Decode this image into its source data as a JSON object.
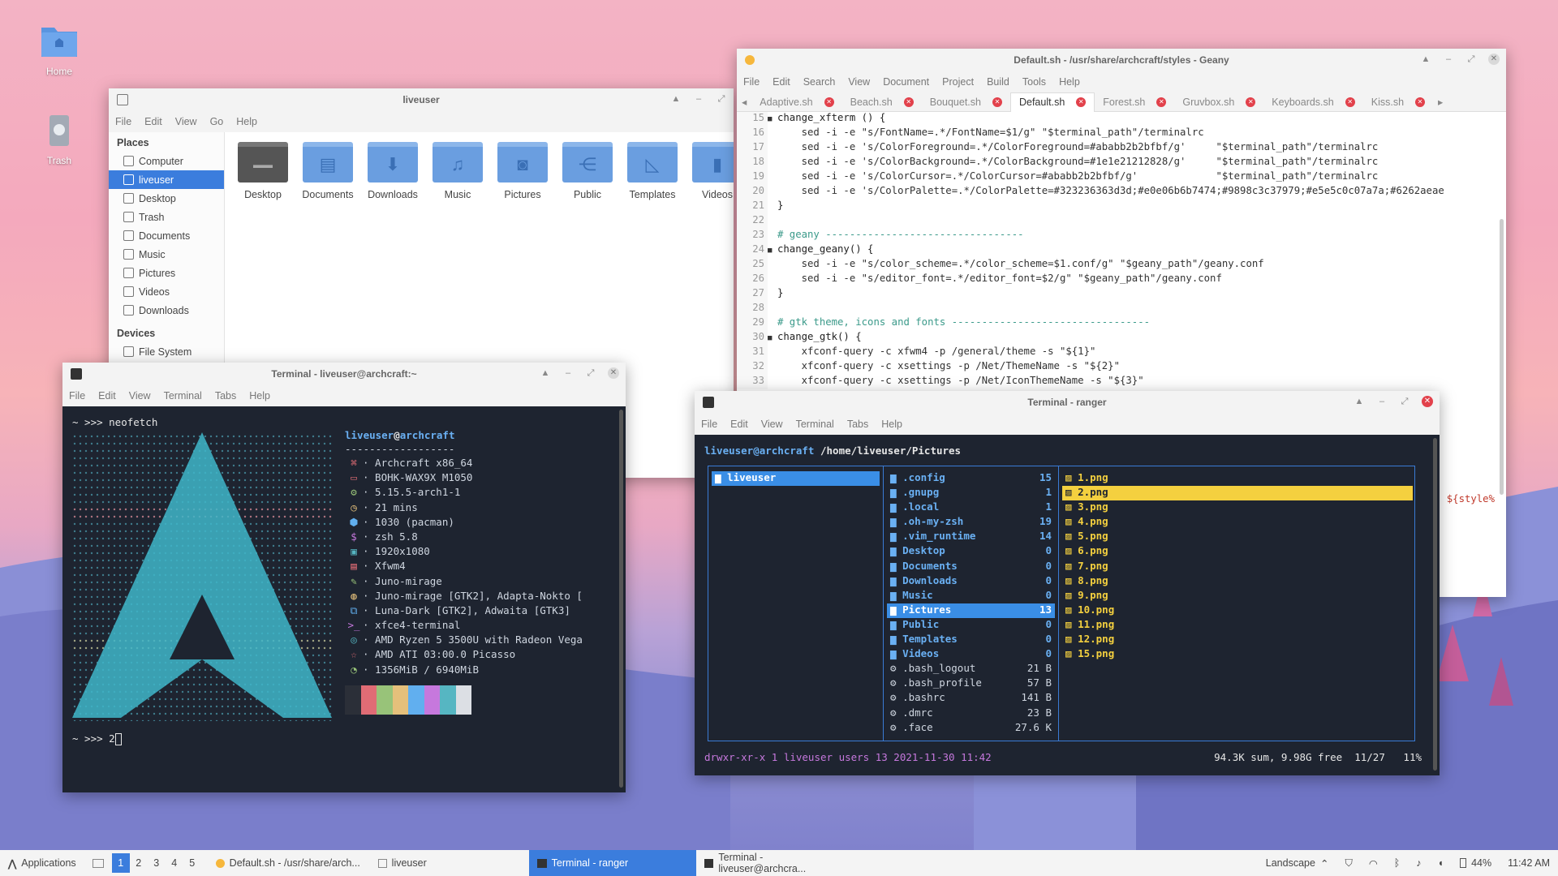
{
  "desktop": {
    "icons": [
      {
        "label": "Home"
      },
      {
        "label": "Trash"
      }
    ]
  },
  "filemanager": {
    "title": "liveuser",
    "menu": [
      "File",
      "Edit",
      "View",
      "Go",
      "Help"
    ],
    "places_header": "Places",
    "places": [
      "Computer",
      "liveuser",
      "Desktop",
      "Trash",
      "Documents",
      "Music",
      "Pictures",
      "Videos",
      "Downloads"
    ],
    "devices_header": "Devices",
    "devices": [
      "File System"
    ],
    "folders": [
      "Desktop",
      "Documents",
      "Downloads",
      "Music",
      "Pictures",
      "Public",
      "Templates",
      "Videos"
    ]
  },
  "geany": {
    "title": "Default.sh - /usr/share/archcraft/styles - Geany",
    "menu": [
      "File",
      "Edit",
      "Search",
      "View",
      "Document",
      "Project",
      "Build",
      "Tools",
      "Help"
    ],
    "tabs": [
      "Adaptive.sh",
      "Beach.sh",
      "Bouquet.sh",
      "Default.sh",
      "Forest.sh",
      "Gruvbox.sh",
      "Keyboards.sh",
      "Kiss.sh"
    ],
    "active_tab": "Default.sh",
    "lines": [
      {
        "n": "15",
        "t": "change_xfterm () {",
        "fold": true
      },
      {
        "n": "16",
        "t": "    sed -i -e \"s/FontName=.*/FontName=$1/g\" \"$terminal_path\"/terminalrc"
      },
      {
        "n": "17",
        "t": "    sed -i -e 's/ColorForeground=.*/ColorForeground=#ababb2b2bfbf/g'     \"$terminal_path\"/terminalrc"
      },
      {
        "n": "18",
        "t": "    sed -i -e 's/ColorBackground=.*/ColorBackground=#1e1e21212828/g'     \"$terminal_path\"/terminalrc"
      },
      {
        "n": "19",
        "t": "    sed -i -e 's/ColorCursor=.*/ColorCursor=#ababb2b2bfbf/g'             \"$terminal_path\"/terminalrc"
      },
      {
        "n": "20",
        "t": "    sed -i -e 's/ColorPalette=.*/ColorPalette=#323236363d3d;#e0e06b6b7474;#9898c3c37979;#e5e5c0c07a7a;#6262aeae"
      },
      {
        "n": "21",
        "t": "}"
      },
      {
        "n": "22",
        "t": ""
      },
      {
        "n": "23",
        "t": "# geany ---------------------------------"
      },
      {
        "n": "24",
        "t": "change_geany() {",
        "fold": true
      },
      {
        "n": "25",
        "t": "    sed -i -e \"s/color_scheme=.*/color_scheme=$1.conf/g\" \"$geany_path\"/geany.conf"
      },
      {
        "n": "26",
        "t": "    sed -i -e \"s/editor_font=.*/editor_font=$2/g\" \"$geany_path\"/geany.conf"
      },
      {
        "n": "27",
        "t": "}"
      },
      {
        "n": "28",
        "t": ""
      },
      {
        "n": "29",
        "t": "# gtk theme, icons and fonts ---------------------------------"
      },
      {
        "n": "30",
        "t": "change_gtk() {",
        "fold": true
      },
      {
        "n": "31",
        "t": "    xfconf-query -c xfwm4 -p /general/theme -s \"${1}\""
      },
      {
        "n": "32",
        "t": "    xfconf-query -c xsettings -p /Net/ThemeName -s \"${2}\""
      },
      {
        "n": "33",
        "t": "    xfconf-query -c xsettings -p /Net/IconThemeName -s \"${3}\""
      }
    ],
    "hidden_fragment": "${style%"
  },
  "term1": {
    "title": "Terminal - liveuser@archcraft:~",
    "menu": [
      "File",
      "Edit",
      "View",
      "Terminal",
      "Tabs",
      "Help"
    ],
    "prompt1": "~ >>> neofetch",
    "user": "liveuser",
    "host": "archcraft",
    "sep": "------------------",
    "info": [
      {
        "icon": "⌘",
        "text": "· Archcraft x86_64"
      },
      {
        "icon": "▭",
        "text": "· BOHK-WAX9X M1050"
      },
      {
        "icon": "⚙",
        "text": "· 5.15.5-arch1-1"
      },
      {
        "icon": "◷",
        "text": "· 21 mins"
      },
      {
        "icon": "⬢",
        "text": "· 1030 (pacman)"
      },
      {
        "icon": "$",
        "text": "· zsh 5.8"
      },
      {
        "icon": "▣",
        "text": "· 1920x1080"
      },
      {
        "icon": "▤",
        "text": "· Xfwm4"
      },
      {
        "icon": "✎",
        "text": "· Juno-mirage"
      },
      {
        "icon": "◍",
        "text": "· Juno-mirage [GTK2], Adapta-Nokto ["
      },
      {
        "icon": "⧉",
        "text": "· Luna-Dark [GTK2], Adwaita [GTK3]"
      },
      {
        "icon": ">_",
        "text": "· xfce4-terminal"
      },
      {
        "icon": "◎",
        "text": "· AMD Ryzen 5 3500U with Radeon Vega"
      },
      {
        "icon": "☆",
        "text": "· AMD ATI 03:00.0 Picasso"
      },
      {
        "icon": "◔",
        "text": "· 1356MiB / 6940MiB"
      }
    ],
    "palette": [
      "#2b2f38",
      "#e06c75",
      "#98c379",
      "#e5c07b",
      "#61afef",
      "#c678dd",
      "#56b6c2",
      "#dcdfe4"
    ],
    "prompt2": "~ >>> 2"
  },
  "term2": {
    "title": "Terminal - ranger",
    "menu": [
      "File",
      "Edit",
      "View",
      "Terminal",
      "Tabs",
      "Help"
    ],
    "header_user": "liveuser@archcraft",
    "header_path": " /home/liveuser/Pictures",
    "col1": [
      "liveuser"
    ],
    "col2": [
      {
        "name": ".config",
        "size": "15",
        "dir": true
      },
      {
        "name": ".gnupg",
        "size": "1",
        "dir": true
      },
      {
        "name": ".local",
        "size": "1",
        "dir": true
      },
      {
        "name": ".oh-my-zsh",
        "size": "19",
        "dir": true
      },
      {
        "name": ".vim_runtime",
        "size": "14",
        "dir": true
      },
      {
        "name": "Desktop",
        "size": "0",
        "dir": true
      },
      {
        "name": "Documents",
        "size": "0",
        "dir": true
      },
      {
        "name": "Downloads",
        "size": "0",
        "dir": true
      },
      {
        "name": "Music",
        "size": "0",
        "dir": true
      },
      {
        "name": "Pictures",
        "size": "13",
        "dir": true,
        "sel": true
      },
      {
        "name": "Public",
        "size": "0",
        "dir": true
      },
      {
        "name": "Templates",
        "size": "0",
        "dir": true
      },
      {
        "name": "Videos",
        "size": "0",
        "dir": true
      },
      {
        "name": ".bash_logout",
        "size": "21 B"
      },
      {
        "name": ".bash_profile",
        "size": "57 B"
      },
      {
        "name": ".bashrc",
        "size": "141 B"
      },
      {
        "name": ".dmrc",
        "size": "23 B"
      },
      {
        "name": ".face",
        "size": "27.6 K"
      }
    ],
    "col3": [
      "1.png",
      "2.png",
      "3.png",
      "4.png",
      "5.png",
      "6.png",
      "7.png",
      "8.png",
      "9.png",
      "10.png",
      "11.png",
      "12.png",
      "15.png"
    ],
    "col3_sel": "2.png",
    "status_left": "drwxr-xr-x 1 liveuser users 13 2021-11-30 11:42",
    "status_right": "94.3K sum, 9.98G free  11/27   11%"
  },
  "taskbar": {
    "apps_label": "Applications",
    "workspaces": [
      "1",
      "2",
      "3",
      "4",
      "5"
    ],
    "tasks": [
      "Default.sh - /usr/share/arch...",
      "liveuser",
      "Terminal - ranger",
      "Terminal - liveuser@archcra..."
    ],
    "layout": "Landscape",
    "battery": "44%",
    "clock": "11:42 AM"
  }
}
